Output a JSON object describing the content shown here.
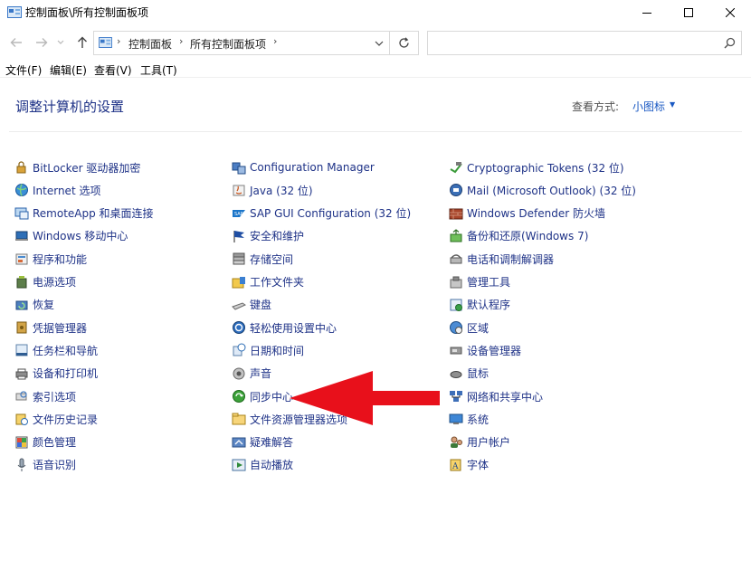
{
  "window": {
    "title": "控制面板\\所有控制面板项"
  },
  "address": {
    "crumbs": [
      "控制面板",
      "所有控制面板项"
    ],
    "search_placeholder": ""
  },
  "menu": [
    "文件(F)",
    "编辑(E)",
    "查看(V)",
    "工具(T)"
  ],
  "header": {
    "title": "调整计算机的设置",
    "view_by_label": "查看方式:",
    "view_by_value": "小图标"
  },
  "columns": [
    [
      {
        "label": "BitLocker 驱动器加密",
        "icon": "key-lock-icon"
      },
      {
        "label": "Internet 选项",
        "icon": "globe-icon"
      },
      {
        "label": "RemoteApp 和桌面连接",
        "icon": "remote-desktop-icon"
      },
      {
        "label": "Windows 移动中心",
        "icon": "mobility-center-icon"
      },
      {
        "label": "程序和功能",
        "icon": "programs-icon"
      },
      {
        "label": "电源选项",
        "icon": "power-icon"
      },
      {
        "label": "恢复",
        "icon": "recovery-icon"
      },
      {
        "label": "凭据管理器",
        "icon": "credential-vault-icon"
      },
      {
        "label": "任务栏和导航",
        "icon": "taskbar-icon"
      },
      {
        "label": "设备和打印机",
        "icon": "printer-icon"
      },
      {
        "label": "索引选项",
        "icon": "indexing-icon"
      },
      {
        "label": "文件历史记录",
        "icon": "file-history-icon"
      },
      {
        "label": "颜色管理",
        "icon": "color-management-icon"
      },
      {
        "label": "语音识别",
        "icon": "microphone-icon"
      }
    ],
    [
      {
        "label": "Configuration Manager",
        "icon": "configuration-manager-icon"
      },
      {
        "label": "Java (32 位)",
        "icon": "java-icon"
      },
      {
        "label": "SAP GUI Configuration (32 位)",
        "icon": "sap-icon"
      },
      {
        "label": "安全和维护",
        "icon": "flag-icon"
      },
      {
        "label": "存储空间",
        "icon": "storage-icon"
      },
      {
        "label": "工作文件夹",
        "icon": "work-folders-icon"
      },
      {
        "label": "键盘",
        "icon": "keyboard-icon"
      },
      {
        "label": "轻松使用设置中心",
        "icon": "ease-of-access-icon"
      },
      {
        "label": "日期和时间",
        "icon": "clock-icon"
      },
      {
        "label": "声音",
        "icon": "speaker-icon"
      },
      {
        "label": "同步中心",
        "icon": "sync-icon"
      },
      {
        "label": "文件资源管理器选项",
        "icon": "folder-options-icon"
      },
      {
        "label": "疑难解答",
        "icon": "troubleshoot-icon"
      },
      {
        "label": "自动播放",
        "icon": "autoplay-icon"
      }
    ],
    [
      {
        "label": "Cryptographic Tokens (32 位)",
        "icon": "token-icon"
      },
      {
        "label": "Mail (Microsoft Outlook) (32 位)",
        "icon": "mail-icon"
      },
      {
        "label": "Windows Defender 防火墙",
        "icon": "firewall-icon"
      },
      {
        "label": "备份和还原(Windows 7)",
        "icon": "backup-icon"
      },
      {
        "label": "电话和调制解调器",
        "icon": "phone-modem-icon"
      },
      {
        "label": "管理工具",
        "icon": "admin-tools-icon"
      },
      {
        "label": "默认程序",
        "icon": "default-programs-icon"
      },
      {
        "label": "区域",
        "icon": "region-icon"
      },
      {
        "label": "设备管理器",
        "icon": "device-manager-icon"
      },
      {
        "label": "鼠标",
        "icon": "mouse-icon"
      },
      {
        "label": "网络和共享中心",
        "icon": "network-icon"
      },
      {
        "label": "系统",
        "icon": "system-icon"
      },
      {
        "label": "用户帐户",
        "icon": "user-accounts-icon"
      },
      {
        "label": "字体",
        "icon": "font-icon"
      }
    ]
  ],
  "colors": {
    "link": "#1e3287",
    "accent": "#1a59c3",
    "arrow": "#e8101b"
  }
}
